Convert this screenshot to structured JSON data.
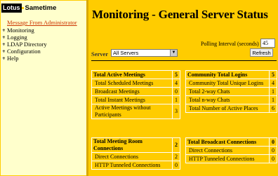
{
  "logo": {
    "brand": "Lotus",
    "product": "Sametime"
  },
  "sidebar": {
    "message": "Message From Administrator",
    "items": [
      {
        "label": "Monitoring"
      },
      {
        "label": "Logging"
      },
      {
        "label": "LDAP Directory"
      },
      {
        "label": "Configuration"
      },
      {
        "label": "Help"
      }
    ]
  },
  "main": {
    "title": "Monitoring - General Server Status",
    "polling_label": "Polling Interval (seconds)",
    "polling_value": "45",
    "refresh_label": "Refresh",
    "server_label": "Server",
    "server_selected": "All Servers"
  },
  "meetings": {
    "title": "Total Active Meetings",
    "total": "5",
    "rows": [
      {
        "label": "Total Scheduled Meetings",
        "value": "4"
      },
      {
        "label": "Broadcast Meetings",
        "value": "0"
      },
      {
        "label": "Total Instant Meetings",
        "value": "1"
      },
      {
        "label": "Active Meetings without Participants",
        "value": "3"
      }
    ]
  },
  "logins": {
    "title": "Community Total Logins",
    "total": "5",
    "rows": [
      {
        "label": "Community Total Unique Logins",
        "value": "4"
      },
      {
        "label": "Total 2-way Chats",
        "value": "1"
      },
      {
        "label": "Total n-way Chats",
        "value": "1"
      },
      {
        "label": "Total Number of Active Places",
        "value": "6"
      }
    ]
  },
  "room_connections": {
    "title": "Total Meeting Room Connections",
    "total": "2",
    "rows": [
      {
        "label": "Direct Connections",
        "value": "2"
      },
      {
        "label": "HTTP Tunneled Connections",
        "value": "0"
      }
    ]
  },
  "broadcast_connections": {
    "title": "Total Broadcast Connections",
    "total": "0",
    "rows": [
      {
        "label": "Direct Connections",
        "value": "0"
      },
      {
        "label": "HTTP Tunneled Connections",
        "value": "0"
      }
    ]
  }
}
